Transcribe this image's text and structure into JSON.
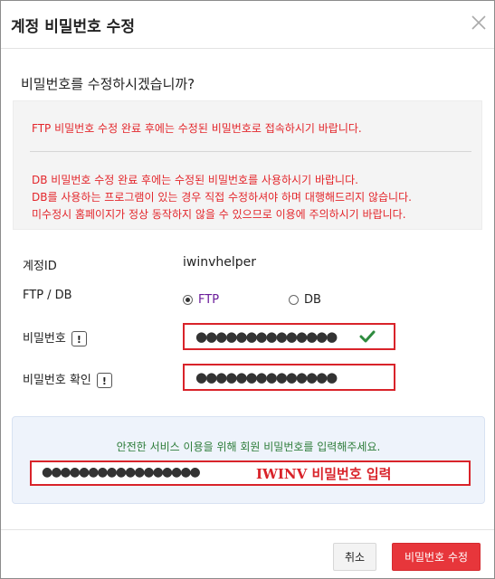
{
  "dialog": {
    "title": "계정 비밀번호 수정",
    "question": "비밀번호를 수정하시겠습니까?"
  },
  "notice": {
    "ftp_line": "FTP 비밀번호 수정 완료 후에는 수정된 비밀번호로 접속하시기 바랍니다.",
    "db_lines": [
      "DB 비밀번호 수정 완료 후에는 수정된 비밀번호를 사용하시기 바랍니다.",
      "DB를 사용하는 프로그램이 있는 경우 직접 수정하셔야 하며 대행해드리지 않습니다.",
      "미수정시 홈페이지가 정상 동작하지 않을 수 있으므로 이용에 주의하시기 바랍니다."
    ],
    "color": "#e3262b"
  },
  "form": {
    "account_id_label": "계정ID",
    "account_id_value": "iwinvhelper",
    "type_label": "FTP / DB",
    "type_options": [
      "FTP",
      "DB"
    ],
    "type_selected": "FTP",
    "password_label": "비밀번호",
    "password_value": "●●●●●●●●●●●●●●",
    "password_confirm_label": "비밀번호 확인",
    "password_confirm_value": "●●●●●●●●●●●●●●",
    "info_glyph": "!"
  },
  "iwinv": {
    "hint": "안전한 서비스 이용을 위해 회원 비밀번호를 입력해주세요.",
    "password_value": "●●●●●●●●●●●●●●●●●",
    "annotation": "IWINV 비밀번호 입력"
  },
  "buttons": {
    "cancel": "취소",
    "submit": "비밀번호 수정"
  },
  "icons": {
    "close": "close-icon",
    "check": "check-icon",
    "info": "info-icon"
  },
  "colors": {
    "accent_red": "#e7363b",
    "highlight_border": "#d9232a",
    "check_green": "#2e8b3e",
    "hint_green": "#2e7d3a",
    "panel_blue": "#eef3fb"
  }
}
